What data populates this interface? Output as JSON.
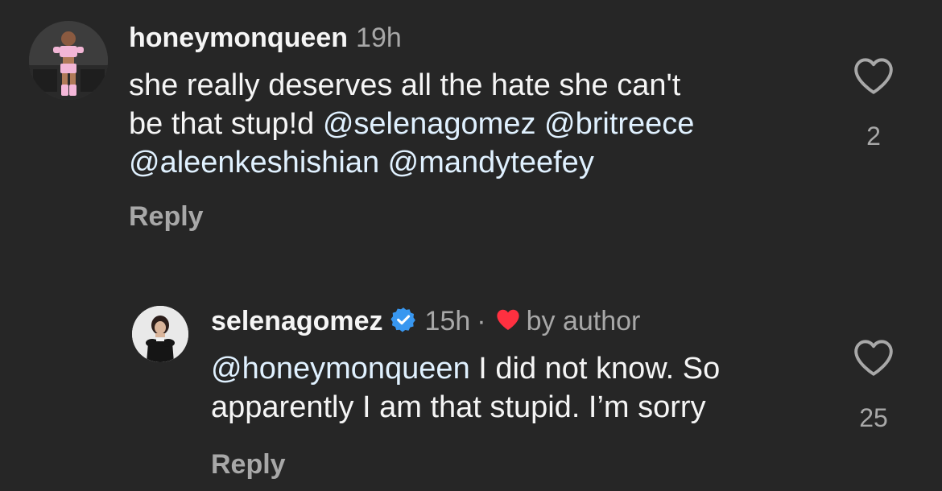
{
  "comment": {
    "username": "honeymonqueen",
    "time": "19h",
    "text_parts": {
      "line1": "she really deserves all the hate she can't",
      "line2_plain": "be that stup!d ",
      "mention1": "@selenagomez",
      "mention2": "@britreece",
      "mention3": "@aleenkeshishian",
      "mention4": "@mandyteefey"
    },
    "reply_label": "Reply",
    "like_count": "2"
  },
  "reply": {
    "username": "selenagomez",
    "time": "15h",
    "separator": "·",
    "liked_label": "by author",
    "mention": "@honeymonqueen",
    "line1_rest": " I did not know. So",
    "line2": "apparently I am that stupid. I’m sorry",
    "reply_label": "Reply",
    "like_count": "25"
  },
  "colors": {
    "background": "#262626",
    "text": "#f5f5f5",
    "secondary": "#a8a8a8",
    "mention": "#e0f1ff",
    "verified": "#3897f0",
    "heart_red": "#ff3040"
  },
  "icons": {
    "like": "heart-outline-icon",
    "verified": "verified-badge-icon",
    "author_like": "heart-filled-icon"
  }
}
